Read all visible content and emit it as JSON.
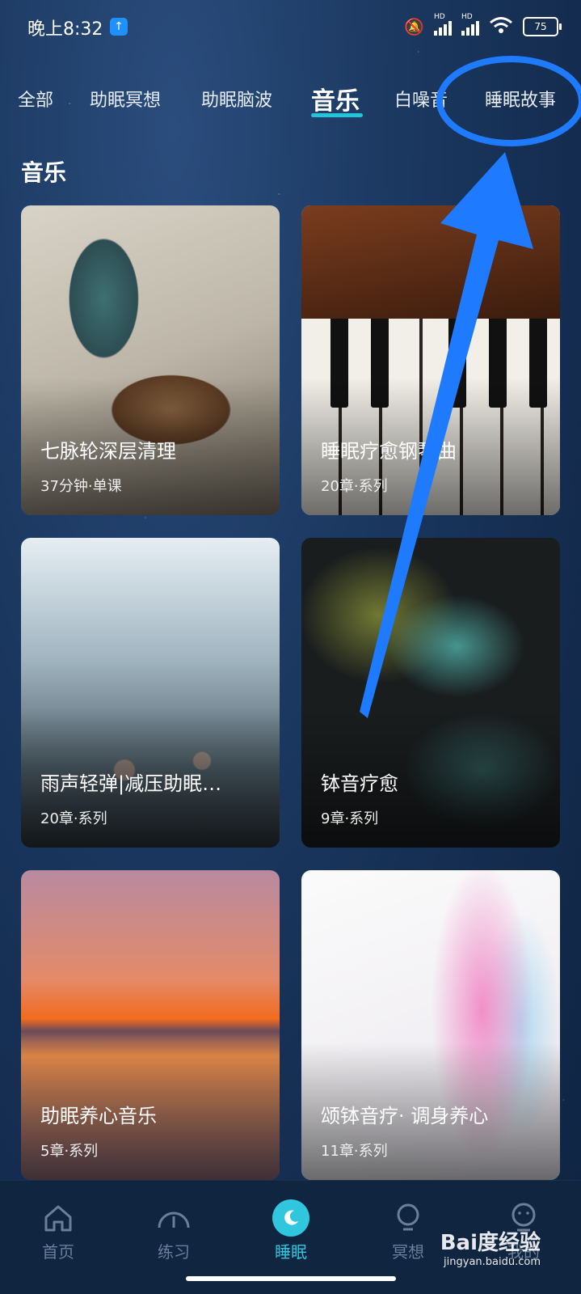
{
  "status_bar": {
    "time": "晚上8:32",
    "battery": "75",
    "hd": "HD"
  },
  "tabs": [
    {
      "label": "全部"
    },
    {
      "label": "助眠冥想"
    },
    {
      "label": "助眠脑波"
    },
    {
      "label": "音乐",
      "active": true
    },
    {
      "label": "白噪音"
    },
    {
      "label": "睡眠故事"
    }
  ],
  "section_title": "音乐",
  "cards": [
    {
      "title": "七脉轮深层清理",
      "meta": "37分钟·单课"
    },
    {
      "title": "睡眠疗愈钢琴曲",
      "meta": "20章·系列"
    },
    {
      "title": "雨声轻弹|减压助眠…",
      "meta": "20章·系列"
    },
    {
      "title": "钵音疗愈",
      "meta": "9章·系列"
    },
    {
      "title": "助眠养心音乐",
      "meta": "5章·系列"
    },
    {
      "title": "颂钵音疗· 调身养心",
      "meta": "11章·系列"
    }
  ],
  "bottom_nav": [
    {
      "label": "首页",
      "icon": "home-icon"
    },
    {
      "label": "练习",
      "icon": "gauge-icon"
    },
    {
      "label": "睡眠",
      "icon": "moon-icon",
      "active": true
    },
    {
      "label": "冥想",
      "icon": "bulb-icon"
    },
    {
      "label": "我的",
      "icon": "user-icon"
    }
  ],
  "watermark": {
    "brand": "Bai度经验",
    "url": "jingyan.baidu.com"
  },
  "colors": {
    "accent": "#2fc6de",
    "annotation": "#1e7bff"
  }
}
